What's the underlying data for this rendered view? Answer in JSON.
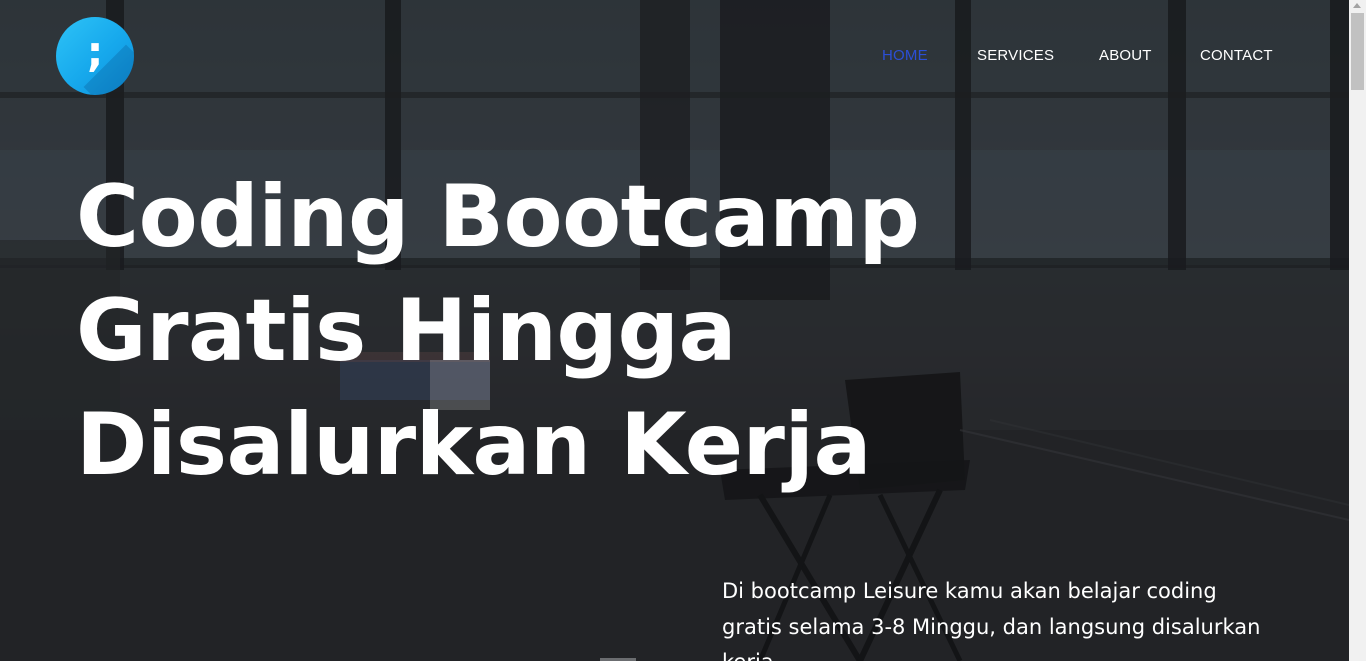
{
  "logo": {
    "glyph": ";",
    "icon": "semicolon-logo-icon",
    "color": "#16a8ec"
  },
  "nav": {
    "items": [
      {
        "label": "HOME",
        "active": true
      },
      {
        "label": "SERVICES",
        "active": false
      },
      {
        "label": "ABOUT",
        "active": false
      },
      {
        "label": "CONTACT",
        "active": false
      }
    ],
    "active_color": "#2b4fd6"
  },
  "hero": {
    "headline_lines": [
      "Coding Bootcamp",
      "Gratis Hingga",
      "Disalurkan Kerja"
    ],
    "description": "Di bootcamp Leisure kamu akan belajar coding gratis selama 3-8 Minggu, dan langsung disalurkan kerja."
  }
}
